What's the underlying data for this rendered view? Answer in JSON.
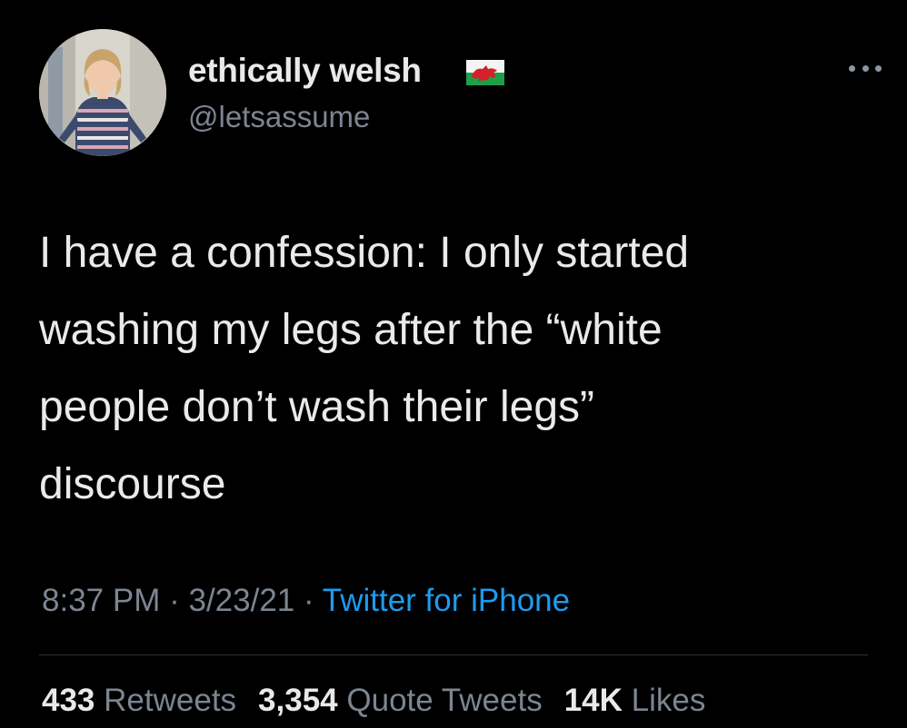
{
  "author": {
    "display_name": "ethically welsh",
    "flag_icon": "wales-flag-icon",
    "handle": "@letsassume"
  },
  "tweet": {
    "lines": [
      "I have a confession: I only started",
      "washing my legs after the “white",
      "people don’t wash their legs”",
      "discourse"
    ]
  },
  "meta": {
    "time": "8:37 PM",
    "separator": "·",
    "date": "3/23/21",
    "source": "Twitter for iPhone"
  },
  "stats": {
    "retweets_count": "433",
    "retweets_label": "Retweets",
    "quotes_count": "3,354",
    "quotes_label": "Quote Tweets",
    "likes_count": "14K",
    "likes_label": "Likes"
  },
  "colors": {
    "background": "#000000",
    "text_primary": "#e7e9ea",
    "text_secondary": "#7c8591",
    "link": "#1d9bf0",
    "divider": "#2f3336"
  }
}
